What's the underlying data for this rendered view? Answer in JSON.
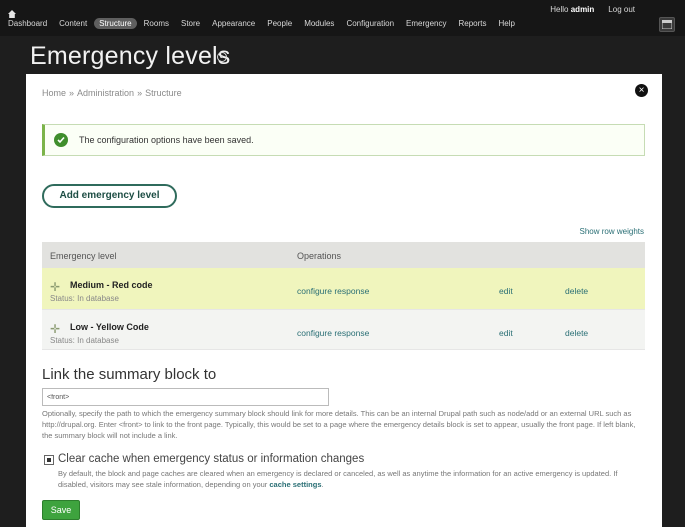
{
  "toolbar": {
    "menu": [
      "Dashboard",
      "Content",
      "Structure",
      "Rooms",
      "Store",
      "Appearance",
      "People",
      "Modules",
      "Configuration",
      "Emergency",
      "Reports",
      "Help"
    ],
    "user_greeting": "Hello",
    "user_name": "admin",
    "logout": "Log out"
  },
  "page": {
    "title": "Emergency levels"
  },
  "modal": {
    "breadcrumb": [
      "Home",
      "Administration",
      "Structure"
    ],
    "breadcrumb_sep": "»",
    "close_label": "×",
    "message": "The configuration options have been saved.",
    "add_button": "Add emergency level",
    "show_weights": "Show row weights",
    "table": {
      "headers": [
        "Emergency level",
        "Operations"
      ],
      "rows": [
        {
          "name": "Medium - Red code",
          "status": "Status: In database",
          "configure": "configure response",
          "edit": "edit",
          "delete": "delete"
        },
        {
          "name": "Low - Yellow Code",
          "status": "Status: In database",
          "configure": "configure response",
          "edit": "edit",
          "delete": "delete"
        }
      ]
    },
    "link_section": {
      "title": "Link the summary block to",
      "input_value": "<front>",
      "description": "Optionally, specify the path to which the emergency summary block should link for more details. This can be an internal Drupal path such as node/add or an external URL such as http://drupal.org. Enter <front> to link to the front page. Typically, this would be set to a page where the emergency details block is set to appear, usually the front page. If left blank, the summary block will not include a link."
    },
    "cache": {
      "checked": true,
      "label": "Clear cache when emergency status or information changes",
      "description": "By default, the block and page caches are cleared when an emergency is declared or canceled, as well as anytime the information for an active emergency is updated. If disabled, visitors may see stale information, depending on your",
      "link": "cache settings",
      "suffix": "."
    },
    "save_button": "Save"
  }
}
